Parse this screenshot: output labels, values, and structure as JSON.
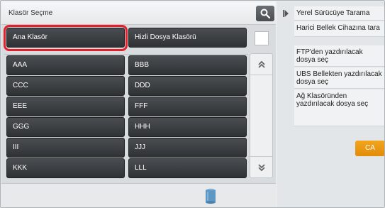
{
  "header": {
    "title": "Klasör Seçme"
  },
  "top_buttons": {
    "ana_klasor": "Ana Klasör",
    "hizli_dosya": "Hizli Dosya Klasörü"
  },
  "folders": [
    [
      "AAA",
      "BBB"
    ],
    [
      "CCC",
      "DDD"
    ],
    [
      "EEE",
      "FFF"
    ],
    [
      "GGG",
      "HHH"
    ],
    [
      "III",
      "JJJ"
    ],
    [
      "KKK",
      "LLL"
    ]
  ],
  "scroll": {
    "up": "⏫",
    "down": "⏬"
  },
  "right_menu": {
    "items": [
      "Yerel Sürücüye Tarama",
      "Harici Bellek Cihazına tara",
      "FTP'den yazdırılacak dosya seç",
      "UBS Bellekten yazdırılacak dosya seç",
      "Ağ Klasöründen yazdırılacak dosya seç"
    ],
    "ca_label": "CA"
  },
  "colors": {
    "highlight": "#e2202c",
    "button_dark": "#3a3d40",
    "ca_orange": "#f0a020"
  },
  "icons": {
    "search": "search-icon",
    "trash": "trash-icon",
    "arrow": "play-arrow-icon"
  }
}
